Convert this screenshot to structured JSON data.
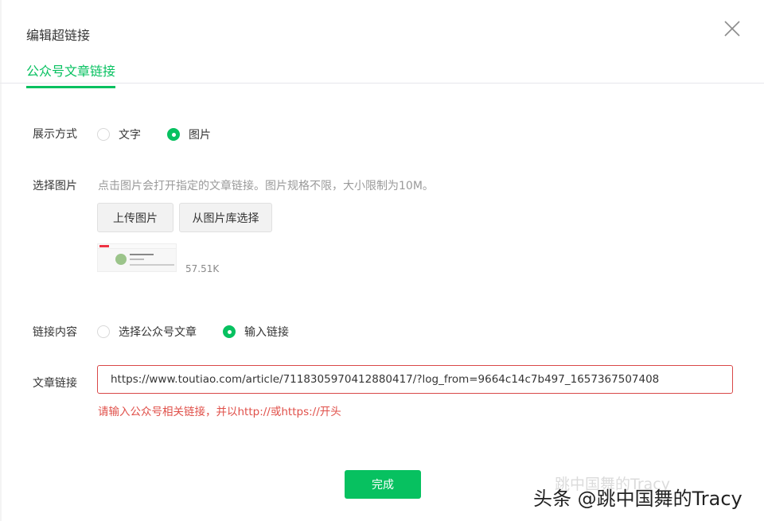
{
  "dialog": {
    "title": "编辑超链接",
    "close_icon": "close-icon",
    "tab_label": "公众号文章链接"
  },
  "display_mode": {
    "label": "展示方式",
    "options": [
      {
        "label": "文字",
        "selected": false
      },
      {
        "label": "图片",
        "selected": true
      }
    ]
  },
  "image_select": {
    "label": "选择图片",
    "hint": "点击图片会打开指定的文章链接。图片规格不限，大小限制为10M。",
    "upload_button": "上传图片",
    "library_button": "从图片库选择",
    "file_size": "57.51K"
  },
  "link_content": {
    "label": "链接内容",
    "options": [
      {
        "label": "选择公众号文章",
        "selected": false
      },
      {
        "label": "输入链接",
        "selected": true
      }
    ]
  },
  "article_link": {
    "label": "文章链接",
    "value": "https://www.toutiao.com/article/7118305970412880417/?log_from=9664c14c7b497_1657367507408",
    "error": "请输入公众号相关链接，并以http://或https://开头"
  },
  "footer": {
    "done_label": "完成"
  },
  "watermark": {
    "faint": "跳中国舞的Tracy",
    "text": "头条 @跳中国舞的Tracy"
  },
  "colors": {
    "accent": "#07c160",
    "error": "#e0504a",
    "text": "#353535",
    "muted": "#9a9a9a"
  }
}
